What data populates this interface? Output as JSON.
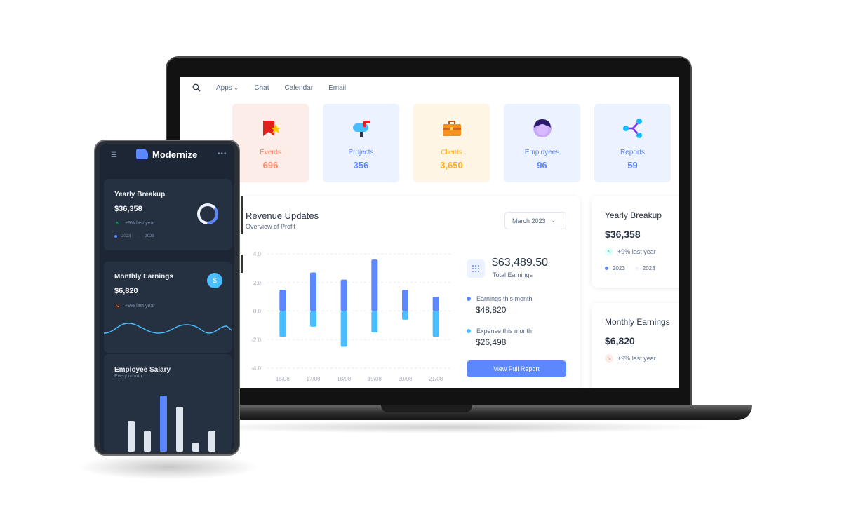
{
  "nav": {
    "items": [
      "Apps",
      "Chat",
      "Calendar",
      "Email"
    ]
  },
  "stats": [
    {
      "label": "Events",
      "value": "696",
      "icon": "flag-star-icon",
      "bg": "#fdede8",
      "color": "#fa896b"
    },
    {
      "label": "Projects",
      "value": "356",
      "icon": "mailbox-icon",
      "bg": "#ecf2ff",
      "color": "#5d87ff"
    },
    {
      "label": "Clients",
      "value": "3,650",
      "icon": "briefcase-icon",
      "bg": "#fef5e5",
      "color": "#ffae1f"
    },
    {
      "label": "Employees",
      "value": "96",
      "icon": "user-avatar-icon",
      "bg": "#ecf2ff",
      "color": "#5d87ff"
    },
    {
      "label": "Reports",
      "value": "59",
      "icon": "connections-icon",
      "bg": "#ecf2ff",
      "color": "#5d87ff"
    }
  ],
  "revenue": {
    "title": "Revenue Updates",
    "subtitle": "Overview of Profit",
    "month": "March 2023",
    "total": "$63,489.50",
    "total_label": "Total Earnings",
    "earnings_label": "Earnings this month",
    "earnings_value": "$48,820",
    "expense_label": "Expense this month",
    "expense_value": "$26,498",
    "button": "View Full Report"
  },
  "chart_data": {
    "type": "bar",
    "categories": [
      "16/08",
      "17/08",
      "18/08",
      "19/08",
      "20/08",
      "21/08"
    ],
    "ylim": [
      -4.0,
      4.0
    ],
    "yticks": [
      "4.0",
      "2.0",
      "0.0",
      "-2.0",
      "-4.0"
    ],
    "series": [
      {
        "values": [
          1.5,
          2.7,
          2.2,
          3.6,
          1.5,
          1.0
        ],
        "color": "#5d87ff"
      },
      {
        "values": [
          -1.8,
          -1.1,
          -2.5,
          -1.5,
          -0.6,
          -1.8
        ],
        "color": "#49beff"
      }
    ]
  },
  "yearly": {
    "title": "Yearly Breakup",
    "value": "$36,358",
    "change": "+9% last year",
    "years": [
      "2023",
      "2023"
    ]
  },
  "monthly": {
    "title": "Monthly Earnings",
    "value": "$6,820",
    "change": "+9% last year"
  },
  "phone": {
    "brand": "Modernize",
    "yearly_title": "Yearly Breakup",
    "yearly_value": "$36,358",
    "yearly_change": "+9% last year",
    "years": [
      "2023",
      "2023"
    ],
    "monthly_title": "Monthly Earnings",
    "monthly_value": "$6,820",
    "monthly_change": "+9% last year",
    "salary_title": "Employee Salary",
    "salary_sub": "Every month",
    "salary_bars": [
      0.55,
      0.37,
      1.0,
      0.8,
      0.16,
      0.37
    ]
  },
  "colors": {
    "primary": "#5d87ff",
    "secondary": "#49beff",
    "success": "#13deb9",
    "danger": "#fa896b"
  }
}
